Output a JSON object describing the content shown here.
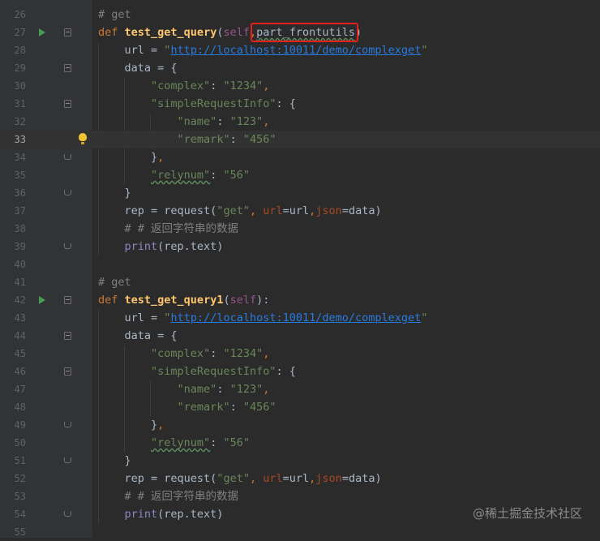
{
  "editor": {
    "line_numbers": [
      "26",
      "27",
      "28",
      "29",
      "30",
      "31",
      "32",
      "33",
      "34",
      "35",
      "36",
      "37",
      "38",
      "39",
      "40",
      "41",
      "42",
      "43",
      "44",
      "45",
      "46",
      "47",
      "48",
      "49",
      "50",
      "51",
      "52",
      "53",
      "54",
      "55"
    ],
    "current_line": "33",
    "highlighted_param": "part_frontutils)"
  },
  "code": {
    "comment_get": "# get",
    "kw_def": "def",
    "func_name_1": "test_get_query",
    "func_name_2": "test_get_query1",
    "self": "self",
    "param": "part_frontutils",
    "url_var": "url",
    "url_value": "http://localhost:10011/demo/complexget",
    "data_var": "data",
    "key_complex": "\"complex\"",
    "val_complex": "\"1234\"",
    "key_simple": "\"simpleRequestInfo\"",
    "key_name": "\"name\"",
    "val_name": "\"123\"",
    "key_remark": "\"remark\"",
    "val_remark": "\"456\"",
    "key_relynum": "\"relynum\"",
    "val_relynum": "\"56\"",
    "rep_call_prefix": "rep = request(",
    "str_get": "\"get\"",
    "kw_url": "url",
    "kw_json": "json",
    "comment_return": "# # 返回字符串的数据",
    "print_fn": "print",
    "print_arg": "(rep.text)"
  },
  "watermark": "@稀土掘金技术社区"
}
